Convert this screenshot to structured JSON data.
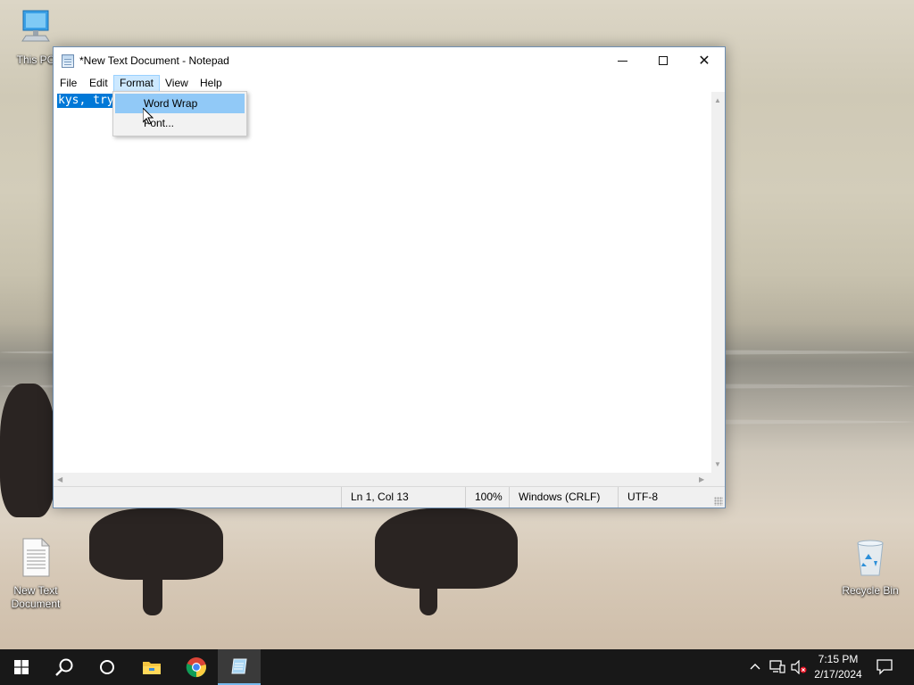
{
  "desktop": {
    "icons": [
      {
        "label": "This PC",
        "glyph": "computer-icon"
      },
      {
        "label": "New Text Document",
        "glyph": "text-document-icon"
      },
      {
        "label": "Recycle Bin",
        "glyph": "recycle-bin-icon"
      }
    ]
  },
  "window": {
    "title": "*New Text Document - Notepad",
    "icon": "notepad-icon",
    "caption_buttons": {
      "close_glyph": "✕"
    }
  },
  "menubar": {
    "items": [
      {
        "label": "File"
      },
      {
        "label": "Edit"
      },
      {
        "label": "Format",
        "active": true
      },
      {
        "label": "View"
      },
      {
        "label": "Help"
      }
    ]
  },
  "format_menu": {
    "items": [
      {
        "label": "Word Wrap",
        "highlighted": true
      },
      {
        "label": "Font..."
      }
    ]
  },
  "editor": {
    "selected_text": "kys, try"
  },
  "statusbar": {
    "position": "Ln 1, Col 13",
    "zoom": "100%",
    "line_endings": "Windows (CRLF)",
    "encoding": "UTF-8"
  },
  "taskbar": {
    "buttons": [
      {
        "name": "start-button",
        "icon": "windows-logo-icon"
      },
      {
        "name": "search-button",
        "icon": "search-icon"
      },
      {
        "name": "cortana-button",
        "icon": "cortana-circle-icon"
      },
      {
        "name": "file-explorer-button",
        "icon": "folder-icon"
      },
      {
        "name": "chrome-button",
        "icon": "chrome-icon"
      },
      {
        "name": "notepad-taskbar-button",
        "icon": "notepad-icon",
        "active": true
      }
    ],
    "tray": {
      "time": "7:15 PM",
      "date": "2/17/2024",
      "icons": [
        "chevron-up-icon",
        "network-icon",
        "volume-muted-icon",
        "notification-icon"
      ]
    }
  },
  "colors": {
    "selection": "#0078d7",
    "menu_active_bg": "#cce8ff",
    "dropdown_hover_bg": "#91c9f7",
    "taskbar_bg": "#181818",
    "accent": "#76b9ed"
  }
}
